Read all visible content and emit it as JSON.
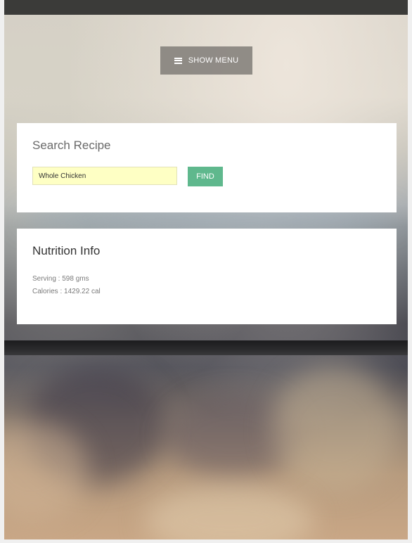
{
  "header": {
    "menu_button_label": "SHOW MENU",
    "menu_icon": "hamburger-icon"
  },
  "search": {
    "title": "Search Recipe",
    "input_value": "Whole Chicken",
    "button_label": "FIND"
  },
  "nutrition": {
    "title": "Nutrition Info",
    "serving": "Serving : 598 gms",
    "calories": "Calories : 1429.22 cal"
  },
  "colors": {
    "find_button": "#5fb88d",
    "input_background": "#feffc4",
    "menu_button": "#807d78"
  }
}
